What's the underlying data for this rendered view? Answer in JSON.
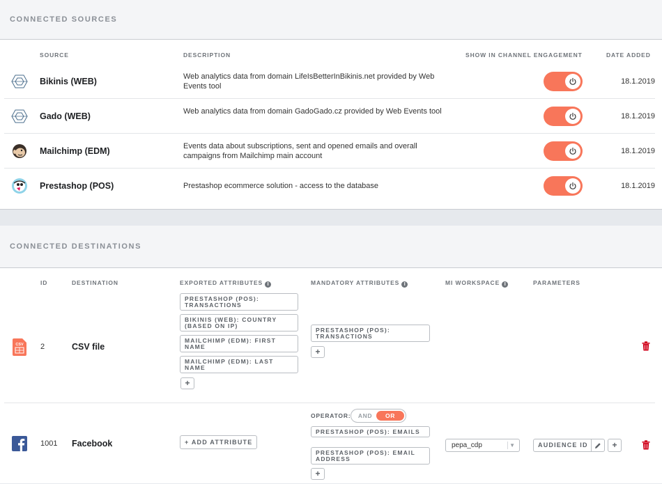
{
  "sources_section": {
    "title": "CONNECTED SOURCES",
    "columns": {
      "source": "SOURCE",
      "description": "DESCRIPTION",
      "show": "SHOW IN CHANNEL ENGAGEMENT",
      "date": "DATE ADDED"
    },
    "rows": [
      {
        "name": "Bikinis (WEB)",
        "icon": "web-events-icon",
        "description": "Web analytics data from domain LifeIsBetterInBikinis.net provided by Web Events tool",
        "enabled": true,
        "date": "18.1.2019"
      },
      {
        "name": "Gado (WEB)",
        "icon": "web-events-icon",
        "description": "Web analytics data from domain GadoGado.cz provided by Web Events tool",
        "enabled": true,
        "date": "18.1.2019"
      },
      {
        "name": "Mailchimp (EDM)",
        "icon": "mailchimp-icon",
        "description": "Events data about subscriptions, sent and opened emails and overall campaigns from Mailchimp main account",
        "enabled": true,
        "date": "18.1.2019"
      },
      {
        "name": "Prestashop (POS)",
        "icon": "prestashop-icon",
        "description": "Prestashop ecommerce solution - access to the database",
        "enabled": true,
        "date": "18.1.2019"
      }
    ]
  },
  "destinations_section": {
    "title": "CONNECTED DESTINATIONS",
    "columns": {
      "id": "ID",
      "destination": "DESTINATION",
      "exported": "EXPORTED ATTRIBUTES",
      "mandatory": "MANDATORY ATTRIBUTES",
      "workspace": "MI WORKSPACE",
      "parameters": "PARAMETERS"
    },
    "rows": [
      {
        "id": "2",
        "name": "CSV file",
        "icon": "csv-file-icon",
        "exported": [
          "PRESTASHOP (POS): TRANSACTIONS",
          "BIKINIS (WEB): COUNTRY (BASED ON IP)",
          "MAILCHIMP (EDM): FIRST NAME",
          "MAILCHIMP (EDM): LAST NAME"
        ],
        "mandatory": [
          "PRESTASHOP (POS): TRANSACTIONS"
        ],
        "add_symbol": "+"
      },
      {
        "id": "1001",
        "name": "Facebook",
        "icon": "facebook-icon",
        "add_attribute_label": "+ ADD ATTRIBUTE",
        "operator_label": "OPERATOR:",
        "operator_options": [
          "AND",
          "OR"
        ],
        "operator_selected": "OR",
        "mandatory": [
          "PRESTASHOP (POS): EMAILS",
          "PRESTASHOP (POS): EMAIL ADDRESS"
        ],
        "workspace": "pepa_cdp",
        "parameter": "AUDIENCE ID",
        "add_symbol": "+"
      }
    ]
  },
  "colors": {
    "accent": "#f8765a",
    "delete": "#d0021b",
    "facebook": "#3b5998"
  }
}
